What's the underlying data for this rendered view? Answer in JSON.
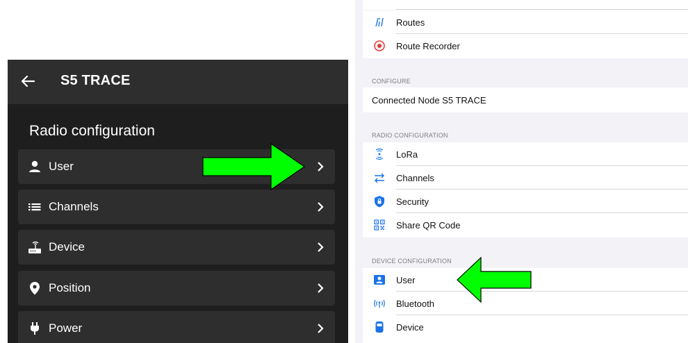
{
  "left_screen": {
    "title": "S5 TRACE",
    "section_title": "Radio configuration",
    "items": [
      {
        "label": "User",
        "icon": "person-icon"
      },
      {
        "label": "Channels",
        "icon": "list-icon"
      },
      {
        "label": "Device",
        "icon": "router-icon"
      },
      {
        "label": "Position",
        "icon": "location-pin-icon"
      },
      {
        "label": "Power",
        "icon": "power-plug-icon"
      }
    ]
  },
  "right_screen": {
    "top_items": [
      {
        "label": "Routes",
        "icon": "routes-icon"
      },
      {
        "label": "Route Recorder",
        "icon": "record-icon"
      }
    ],
    "configure_header": "CONFIGURE",
    "connected_node": "Connected Node S5 TRACE",
    "radio_header": "RADIO CONFIGURATION",
    "radio_items": [
      {
        "label": "LoRa",
        "icon": "lora-antenna-icon"
      },
      {
        "label": "Channels",
        "icon": "channels-icon"
      },
      {
        "label": "Security",
        "icon": "shield-lock-icon"
      },
      {
        "label": "Share QR Code",
        "icon": "qr-code-icon"
      }
    ],
    "device_header": "DEVICE CONFIGURATION",
    "device_items": [
      {
        "label": "User",
        "icon": "user-card-icon"
      },
      {
        "label": "Bluetooth",
        "icon": "bluetooth-signal-icon"
      },
      {
        "label": "Device",
        "icon": "device-icon"
      }
    ]
  },
  "colors": {
    "android_bg": "#1e1e1e",
    "android_row": "#2e2e2e",
    "ios_bg": "#f2f2f7",
    "ios_accent": "#1a73e8",
    "record_red": "#e53935",
    "arrow_green": "#00ff00"
  }
}
